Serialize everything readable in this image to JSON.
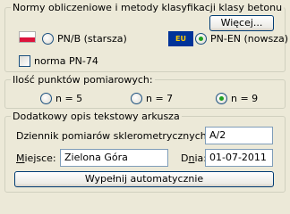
{
  "group1": {
    "title": "Normy obliczeniowe i metody klasyfikacji klasy betonu",
    "more_button": "Więcej...",
    "radio_pn": "PN/B (starsza)",
    "eu_badge": "EU",
    "radio_pnen": "PN-EN (nowsza)",
    "checkbox_label": "norma PN-74"
  },
  "group2": {
    "title": "Ilość punktów pomiarowych:",
    "options": [
      "n = 5",
      "n = 7",
      "n = 9"
    ]
  },
  "group3": {
    "title": "Dodatkowy opis tekstowy arkusza",
    "journal_label": "Dziennik pomiarów sklerometrycznych nr:",
    "journal_value": "A/2",
    "place_label_first": "M",
    "place_label_rest": "iejsce:",
    "place_value": "Zielona Góra",
    "date_label_start": "D",
    "date_label_underlined": "n",
    "date_label_end": "ia:",
    "date_value": "01-07-2011",
    "fill_button": "Wypełnij automatycznie"
  },
  "colors": {
    "flag_pl_top": "#ffffff",
    "flag_pl_bottom": "#dc143c",
    "flag_eu_bg": "#003399",
    "flag_eu_stars": "#ffcc00",
    "radio_dot": "#21a121"
  }
}
